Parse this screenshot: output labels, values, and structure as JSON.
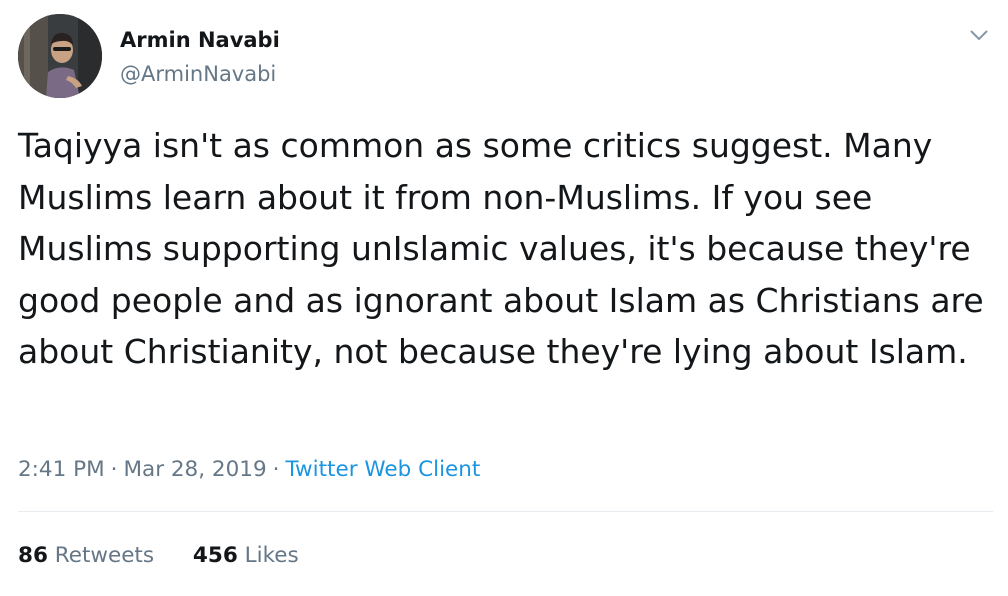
{
  "author": {
    "name": "Armin Navabi",
    "handle": "@ArminNavabi",
    "avatar_icon": "profile-photo"
  },
  "menu": {
    "icon": "chevron-down-icon"
  },
  "tweet": {
    "text": "Taqiyya isn't as common as some critics suggest. Many Muslims learn about it from non-Muslims. If you see Muslims supporting unIslamic values, it's because they're good people and as ignorant about Islam as Christians are about Christianity, not because they're lying about Islam.",
    "time": "2:41 PM",
    "separator": "·",
    "date": "Mar 28, 2019",
    "client": "Twitter Web Client"
  },
  "stats": {
    "retweets_count": "86",
    "retweets_label": "Retweets",
    "likes_count": "456",
    "likes_label": "Likes"
  },
  "colors": {
    "text": "#14171a",
    "secondary": "#657786",
    "link": "#1b95e0",
    "divider": "#e6ecf0"
  }
}
